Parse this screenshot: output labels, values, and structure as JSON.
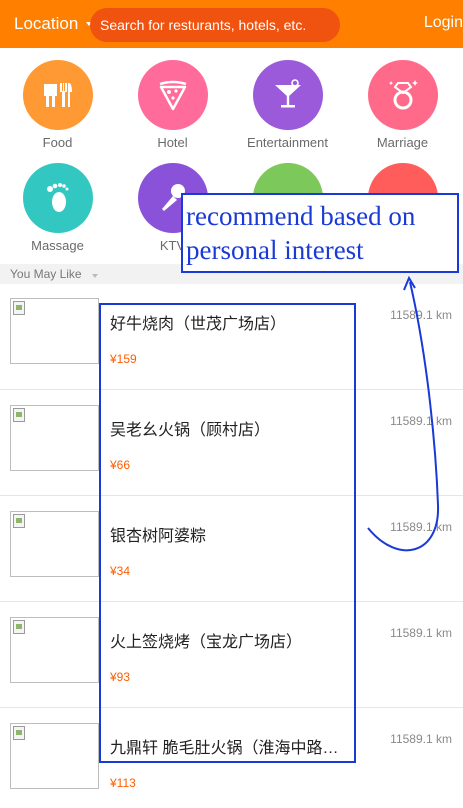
{
  "header": {
    "location_label": "Location",
    "search_placeholder": "Search for resturants, hotels, etc.",
    "login_label": "Login"
  },
  "categories": [
    {
      "label": "Food",
      "icon": "food-icon",
      "color": "#ff9933"
    },
    {
      "label": "Hotel",
      "icon": "pizza-slice-icon",
      "color": "#ff6b9b"
    },
    {
      "label": "Entertainment",
      "icon": "cocktail-icon",
      "color": "#9b5ad9"
    },
    {
      "label": "Marriage",
      "icon": "ring-icon",
      "color": "#ff6a8a"
    },
    {
      "label": "Massage",
      "icon": "footprint-icon",
      "color": "#33c7c2"
    },
    {
      "label": "KTV",
      "icon": "microphone-icon",
      "color": "#8a52d9"
    },
    {
      "label": "",
      "icon": "category-icon",
      "color": "#7cc85a"
    },
    {
      "label": "",
      "icon": "category-icon",
      "color": "#ff5c5c"
    }
  ],
  "section": {
    "title": "You May Like"
  },
  "items": [
    {
      "name": "好牛烧肉（世茂广场店）",
      "price": "¥159",
      "distance": "11589.1 km"
    },
    {
      "name": "吴老幺火锅（顾村店）",
      "price": "¥66",
      "distance": "11589.1 km"
    },
    {
      "name": "银杏树阿婆粽",
      "price": "¥34",
      "distance": "11589.1 km"
    },
    {
      "name": "火上签烧烤（宝龙广场店）",
      "price": "¥93",
      "distance": "11589.1 km"
    },
    {
      "name": "九鼎轩 脆毛肚火锅（淮海中路…",
      "price": "¥113",
      "distance": "11589.1 km"
    }
  ],
  "annotation": {
    "line1": "recommend based on",
    "line2": "personal interest",
    "color": "#1a3ad8"
  }
}
